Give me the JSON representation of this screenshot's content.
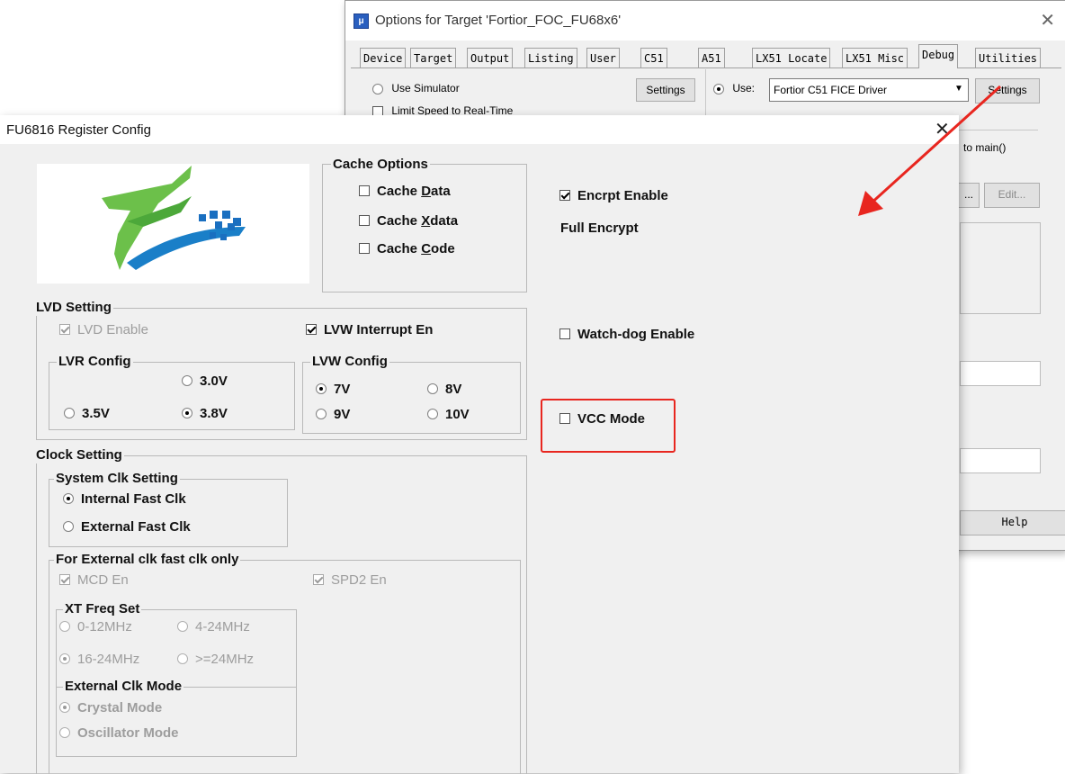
{
  "options_window": {
    "title": "Options for Target 'Fortior_FOC_FU68x6'",
    "icon": "keil-uv-icon",
    "tabs": [
      "Device",
      "Target",
      "Output",
      "Listing",
      "User",
      "C51",
      "A51",
      "LX51 Locate",
      "LX51 Misc",
      "Debug",
      "Utilities"
    ],
    "active_tab": "Debug",
    "use_simulator_label": "Use Simulator",
    "settings_label": "Settings",
    "use_label": "Use:",
    "driver_value": "Fortior C51 FICE Driver",
    "settings2_label": "Settings",
    "limit_speed_label": "Limit Speed to Real-Time",
    "run_to_main_label": "to main()",
    "ellipsis_label": "...",
    "edit_label": "Edit...",
    "help_label": "Help"
  },
  "config_dialog": {
    "title": "FU6816 Register Config",
    "close_label": "✕",
    "cache_options": {
      "label": "Cache Options",
      "items": [
        {
          "pre": "Cache ",
          "u": "D",
          "post": "ata",
          "checked": false
        },
        {
          "pre": "Cache ",
          "u": "X",
          "post": "data",
          "checked": false
        },
        {
          "pre": "Cache ",
          "u": "C",
          "post": "ode",
          "checked": false
        }
      ]
    },
    "encrypt_enable": {
      "label": "Encrpt Enable",
      "checked": true
    },
    "full_encrypt_label": "Full Encrypt",
    "watchdog_enable": {
      "label": "Watch-dog Enable",
      "checked": false
    },
    "vcc_mode": {
      "label": "VCC Mode",
      "checked": false
    },
    "lvd_setting": {
      "label": "LVD Setting",
      "lvd_enable": {
        "label": "LVD Enable",
        "checked": true
      },
      "lvw_interrupt": {
        "label": "LVW Interrupt En",
        "checked": true
      },
      "lvr_config": {
        "label": "LVR Config",
        "options": [
          "3.0V",
          "3.5V",
          "3.8V"
        ],
        "selected": "3.8V"
      },
      "lvw_config": {
        "label": "LVW Config",
        "options": [
          "7V",
          "8V",
          "9V",
          "10V"
        ],
        "selected": "7V"
      }
    },
    "clock_setting": {
      "label": "Clock Setting",
      "system_clk": {
        "label": "System Clk Setting",
        "options": [
          "Internal Fast Clk",
          "External Fast Clk"
        ],
        "selected": "Internal Fast Clk"
      },
      "external_only": {
        "label": "For External clk fast clk only",
        "mcd_en": {
          "label": "MCD En",
          "checked": true
        },
        "spd2_en": {
          "label": "SPD2 En",
          "checked": true
        },
        "xt_freq": {
          "label": "XT Freq Set",
          "options": [
            "0-12MHz",
            "4-24MHz",
            "16-24MHz",
            ">=24MHz"
          ],
          "selected": "16-24MHz"
        },
        "ext_clk_mode": {
          "label": "External Clk Mode",
          "options": [
            "Crystal Mode",
            "Oscillator Mode"
          ],
          "selected": "Crystal Mode"
        }
      }
    }
  },
  "annotation": {
    "highlight_color": "#e8261f",
    "arrow_color": "#e8261f"
  }
}
